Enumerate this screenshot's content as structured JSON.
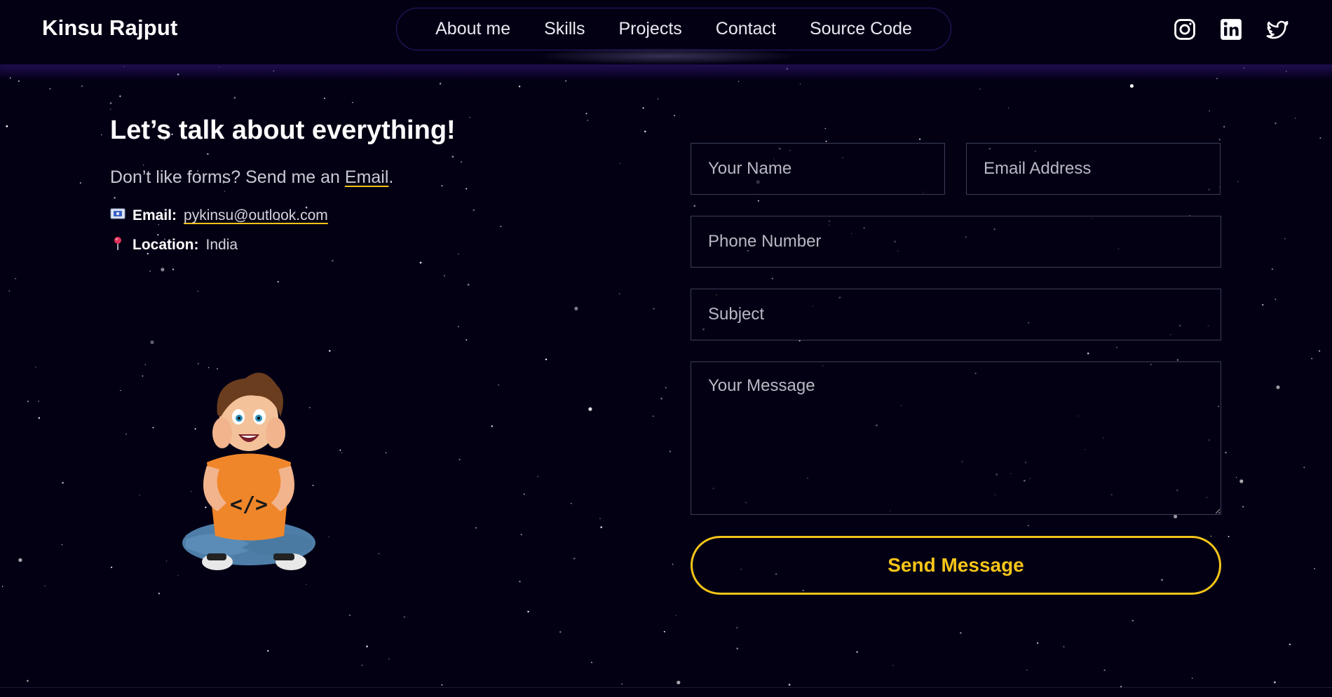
{
  "header": {
    "brand": "Kinsu Rajput",
    "nav": [
      "About me",
      "Skills",
      "Projects",
      "Contact",
      "Source Code"
    ],
    "socials": [
      "instagram-icon",
      "linkedin-icon",
      "twitter-icon"
    ]
  },
  "contact": {
    "heading": "Let’s talk about everything!",
    "subtext_prefix": "Don’t like forms? Send me an ",
    "subtext_link": "Email",
    "subtext_suffix": ".",
    "email_label": "Email:",
    "email_value": "pykinsu@outlook.com",
    "location_label": "Location:",
    "location_value": "India"
  },
  "form": {
    "name_placeholder": "Your Name",
    "email_placeholder": "Email Address",
    "phone_placeholder": "Phone Number",
    "subject_placeholder": "Subject",
    "message_placeholder": "Your Message",
    "send_label": "Send Message"
  },
  "colors": {
    "background": "#030014",
    "accent": "#f5c518",
    "nav_border": "#2b1a6e"
  }
}
